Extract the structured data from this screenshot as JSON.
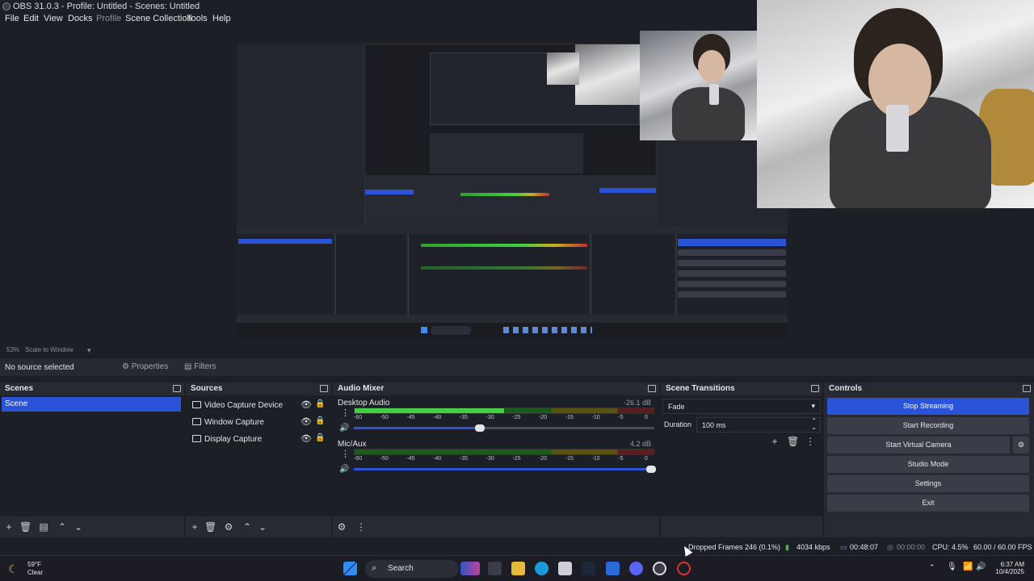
{
  "window": {
    "title": "OBS 31.0.3 - Profile: Untitled - Scenes: Untitled"
  },
  "menu": {
    "file": "File",
    "edit": "Edit",
    "view": "View",
    "docks": "Docks",
    "profile": "Profile",
    "scene_collection": "Scene Collection",
    "tools": "Tools",
    "help": "Help"
  },
  "preview_status": {
    "zoom": "53%",
    "scale_mode": "Scale to Window"
  },
  "source_bar": {
    "no_source": "No source selected",
    "properties": "Properties",
    "filters": "Filters"
  },
  "scenes": {
    "title": "Scenes",
    "items": [
      "Scene"
    ]
  },
  "sources": {
    "title": "Sources",
    "items": [
      "Video Capture Device",
      "Window Capture",
      "Display Capture"
    ]
  },
  "audio_mixer": {
    "title": "Audio Mixer",
    "ticks": [
      "-60",
      "-50",
      "-45",
      "-40",
      "-35",
      "-30",
      "-25",
      "-20",
      "-15",
      "-10",
      "-5",
      "0"
    ],
    "channels": [
      {
        "name": "Desktop Audio",
        "db": "-26.1 dB",
        "level": 0.5,
        "volume": 0.42
      },
      {
        "name": "Mic/Aux",
        "db": "4.2 dB",
        "level": 0.0,
        "volume": 0.99
      }
    ]
  },
  "scene_transitions": {
    "title": "Scene Transitions",
    "transition": "Fade",
    "duration_label": "Duration",
    "duration_value": "100 ms"
  },
  "controls": {
    "title": "Controls",
    "stop_streaming": "Stop Streaming",
    "start_recording": "Start Recording",
    "start_virtual_camera": "Start Virtual Camera",
    "studio_mode": "Studio Mode",
    "settings": "Settings",
    "exit": "Exit"
  },
  "status": {
    "dropped_frames": "Dropped Frames 246 (0.1%)",
    "bitrate": "4034 kbps",
    "stream_time": "00:48:07",
    "rec_time": "00:00:00",
    "cpu": "CPU: 4.5%",
    "fps": "60.00 / 60.00 FPS"
  },
  "taskbar": {
    "weather_temp": "59°F",
    "weather_desc": "Clear",
    "search": "Search",
    "time": "6:37 AM",
    "date": "10/4/2025"
  }
}
